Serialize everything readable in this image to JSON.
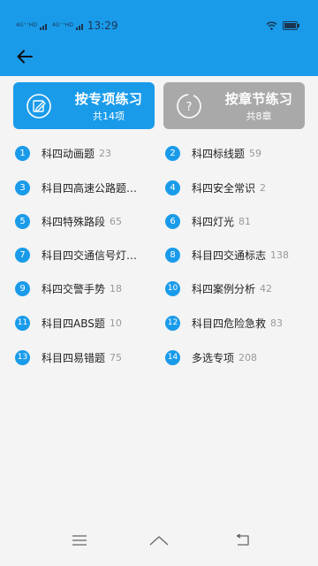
{
  "status_bar": {
    "signal_tags": [
      "4G⁺⁺HD",
      "4G⁺⁺HD"
    ],
    "time": "13:29"
  },
  "colors": {
    "accent": "#1a9bea",
    "disabled_card": "#a9a9a9",
    "count_text": "#999999"
  },
  "mode_cards": [
    {
      "title": "按专项练习",
      "subtitle": "共14项",
      "icon": "edit-icon"
    },
    {
      "title": "按章节练习",
      "subtitle": "共8章",
      "icon": "help-icon"
    }
  ],
  "topics": [
    {
      "num": "1",
      "label": "科四动画题",
      "count": "23"
    },
    {
      "num": "2",
      "label": "科四标线题",
      "count": "59"
    },
    {
      "num": "3",
      "label": "科目四高速公路题…",
      "count": ""
    },
    {
      "num": "4",
      "label": "科四安全常识",
      "count": "2"
    },
    {
      "num": "5",
      "label": "科四特殊路段",
      "count": "65"
    },
    {
      "num": "6",
      "label": "科四灯光",
      "count": "81"
    },
    {
      "num": "7",
      "label": "科目四交通信号灯…",
      "count": ""
    },
    {
      "num": "8",
      "label": "科目四交通标志",
      "count": "138"
    },
    {
      "num": "9",
      "label": "科四交警手势",
      "count": "18"
    },
    {
      "num": "10",
      "label": "科四案例分析",
      "count": "42"
    },
    {
      "num": "11",
      "label": "科目四ABS题",
      "count": "10"
    },
    {
      "num": "12",
      "label": "科目四危险急救",
      "count": "83"
    },
    {
      "num": "13",
      "label": "科目四易错题",
      "count": "75"
    },
    {
      "num": "14",
      "label": "多选专项",
      "count": "208"
    }
  ]
}
